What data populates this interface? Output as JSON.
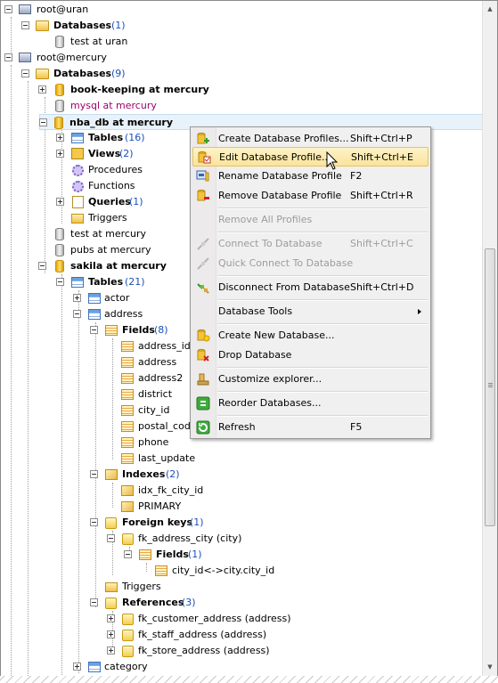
{
  "tree": [
    {
      "id": "root-uran",
      "label": "root@uran",
      "bold": false,
      "count": "",
      "pink": false
    },
    {
      "id": "databases-uran",
      "label": "Databases",
      "bold": true,
      "count": "(1)",
      "pink": false
    },
    {
      "id": "test-uran",
      "label": "test at uran",
      "bold": false,
      "count": "",
      "pink": false
    },
    {
      "id": "root-mercury",
      "label": "root@mercury",
      "bold": false,
      "count": "",
      "pink": false
    },
    {
      "id": "databases-mercury",
      "label": "Databases",
      "bold": true,
      "count": "(9)",
      "pink": false
    },
    {
      "id": "book-keeping",
      "label": "book-keeping at mercury",
      "bold": true,
      "count": "",
      "pink": false
    },
    {
      "id": "mysql",
      "label": "mysql at mercury",
      "bold": false,
      "count": "",
      "pink": true
    },
    {
      "id": "nba-db",
      "label": "nba_db at mercury",
      "bold": true,
      "count": "",
      "pink": false
    },
    {
      "id": "nba-tables",
      "label": "Tables",
      "bold": true,
      "count": "(16)",
      "pink": false
    },
    {
      "id": "nba-views",
      "label": "Views",
      "bold": true,
      "count": "(2)",
      "pink": false
    },
    {
      "id": "nba-procedures",
      "label": "Procedures",
      "bold": false,
      "count": "",
      "pink": false
    },
    {
      "id": "nba-functions",
      "label": "Functions",
      "bold": false,
      "count": "",
      "pink": false
    },
    {
      "id": "nba-queries",
      "label": "Queries",
      "bold": true,
      "count": "(1)",
      "pink": false
    },
    {
      "id": "nba-triggers",
      "label": "Triggers",
      "bold": false,
      "count": "",
      "pink": false
    },
    {
      "id": "test-mercury",
      "label": "test at mercury",
      "bold": false,
      "count": "",
      "pink": false
    },
    {
      "id": "pubs-mercury",
      "label": "pubs at mercury",
      "bold": false,
      "count": "",
      "pink": false
    },
    {
      "id": "sakila",
      "label": "sakila at mercury",
      "bold": true,
      "count": "",
      "pink": false
    },
    {
      "id": "sakila-tables",
      "label": "Tables",
      "bold": true,
      "count": "(21)",
      "pink": false
    },
    {
      "id": "actor",
      "label": "actor",
      "bold": false,
      "count": "",
      "pink": false
    },
    {
      "id": "address",
      "label": "address",
      "bold": false,
      "count": "",
      "pink": false
    },
    {
      "id": "address-fields",
      "label": "Fields",
      "bold": true,
      "count": "(8)",
      "pink": false
    },
    {
      "id": "f-address-id",
      "label": "address_id",
      "bold": false,
      "count": "",
      "pink": false
    },
    {
      "id": "f-address",
      "label": "address",
      "bold": false,
      "count": "",
      "pink": false
    },
    {
      "id": "f-address2",
      "label": "address2",
      "bold": false,
      "count": "",
      "pink": false
    },
    {
      "id": "f-district",
      "label": "district",
      "bold": false,
      "count": "",
      "pink": false
    },
    {
      "id": "f-city-id",
      "label": "city_id",
      "bold": false,
      "count": "",
      "pink": false
    },
    {
      "id": "f-postal-code",
      "label": "postal_code",
      "bold": false,
      "count": "",
      "pink": false
    },
    {
      "id": "f-phone",
      "label": "phone",
      "bold": false,
      "count": "",
      "pink": false
    },
    {
      "id": "f-last-update",
      "label": "last_update",
      "bold": false,
      "count": "",
      "pink": false
    },
    {
      "id": "indexes",
      "label": "Indexes",
      "bold": true,
      "count": "(2)",
      "pink": false
    },
    {
      "id": "idx-fk-city-id",
      "label": "idx_fk_city_id",
      "bold": false,
      "count": "",
      "pink": false
    },
    {
      "id": "primary",
      "label": "PRIMARY",
      "bold": false,
      "count": "",
      "pink": false
    },
    {
      "id": "foreign-keys",
      "label": "Foreign keys",
      "bold": true,
      "count": "(1)",
      "pink": false
    },
    {
      "id": "fk-address-city",
      "label": "fk_address_city (city)",
      "bold": false,
      "count": "",
      "pink": false
    },
    {
      "id": "fk-fields",
      "label": "Fields",
      "bold": true,
      "count": "(1)",
      "pink": false
    },
    {
      "id": "city-id-ref",
      "label": "city_id<->city.city_id",
      "bold": false,
      "count": "",
      "pink": false
    },
    {
      "id": "address-triggers",
      "label": "Triggers",
      "bold": false,
      "count": "",
      "pink": false
    },
    {
      "id": "references",
      "label": "References",
      "bold": true,
      "count": "(3)",
      "pink": false
    },
    {
      "id": "fk-customer-address",
      "label": "fk_customer_address (address)",
      "bold": false,
      "count": "",
      "pink": false
    },
    {
      "id": "fk-staff-address",
      "label": "fk_staff_address (address)",
      "bold": false,
      "count": "",
      "pink": false
    },
    {
      "id": "fk-store-address",
      "label": "fk_store_address (address)",
      "bold": false,
      "count": "",
      "pink": false
    },
    {
      "id": "category",
      "label": "category",
      "bold": false,
      "count": "",
      "pink": false
    }
  ],
  "menu": [
    {
      "label": "Create Database Profiles...",
      "shortcut": "Shift+Ctrl+P",
      "disabled": false,
      "icon": "db-add-icon"
    },
    {
      "label": "Edit Database Profile...",
      "shortcut": "Shift+Ctrl+E",
      "disabled": false,
      "icon": "db-edit-icon",
      "highlighted": true
    },
    {
      "label": "Rename Database Profile",
      "shortcut": "F2",
      "disabled": false,
      "icon": "db-rename-icon"
    },
    {
      "label": "Remove Database Profile",
      "shortcut": "Shift+Ctrl+R",
      "disabled": false,
      "icon": "db-remove-icon"
    },
    {
      "label": "Remove All Profiles",
      "shortcut": "",
      "disabled": true,
      "icon": ""
    },
    {
      "label": "Connect To Database",
      "shortcut": "Shift+Ctrl+C",
      "disabled": true,
      "icon": "connect-icon"
    },
    {
      "label": "Quick Connect To Database",
      "shortcut": "",
      "disabled": true,
      "icon": "quick-connect-icon"
    },
    {
      "label": "Disconnect From Database",
      "shortcut": "Shift+Ctrl+D",
      "disabled": false,
      "icon": "disconnect-icon"
    },
    {
      "label": "Database Tools",
      "shortcut": "",
      "disabled": false,
      "icon": "",
      "submenu": true
    },
    {
      "label": "Create New Database...",
      "shortcut": "",
      "disabled": false,
      "icon": "db-new-icon"
    },
    {
      "label": "Drop Database",
      "shortcut": "",
      "disabled": false,
      "icon": "db-drop-icon"
    },
    {
      "label": "Customize explorer...",
      "shortcut": "",
      "disabled": false,
      "icon": "customize-icon"
    },
    {
      "label": "Reorder Databases...",
      "shortcut": "",
      "disabled": false,
      "icon": "reorder-icon"
    },
    {
      "label": "Refresh",
      "shortcut": "F5",
      "disabled": false,
      "icon": "refresh-icon"
    }
  ],
  "colors": {
    "count": "#1c4fb9",
    "pink": "#a0006d",
    "highlight": "#fbe39a",
    "selection": "#e8f2fb"
  }
}
